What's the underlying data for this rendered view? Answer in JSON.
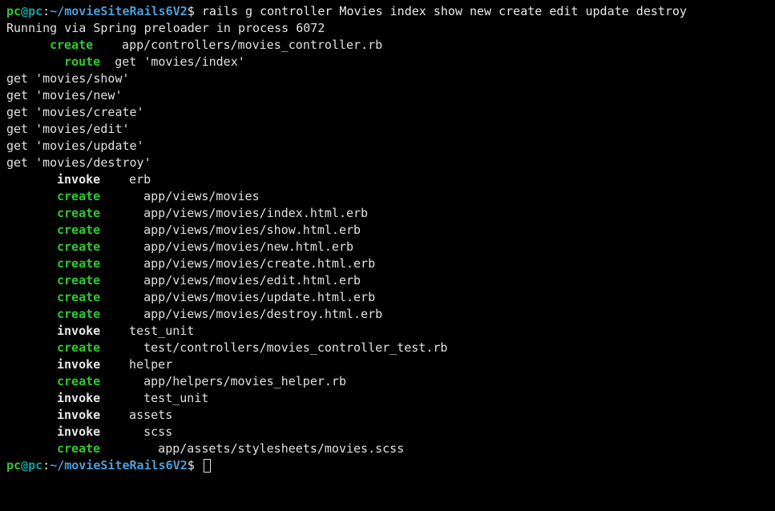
{
  "prompt1": {
    "user": "pc",
    "at": "@",
    "host": "pc",
    "colon": ":",
    "path": "~/movieSiteRails6V2",
    "dollar": "$",
    "command": "rails g controller Movies index show new create edit update destroy"
  },
  "lines": {
    "spring": "Running via Spring preloader in process 6072",
    "create1_action": "create",
    "create1_path": "  app/controllers/movies_controller.rb",
    "route_action": "route",
    "route_path": "  get 'movies/index'",
    "get_show": "get 'movies/show'",
    "get_new": "get 'movies/new'",
    "get_create": "get 'movies/create'",
    "get_edit": "get 'movies/edit'",
    "get_update": "get 'movies/update'",
    "get_destroy": "get 'movies/destroy'",
    "invoke_erb_action": "invoke",
    "invoke_erb_path": "  erb",
    "create_views_action": "create",
    "create_views_path": "    app/views/movies",
    "create_index_action": "create",
    "create_index_path": "    app/views/movies/index.html.erb",
    "create_show_action": "create",
    "create_show_path": "    app/views/movies/show.html.erb",
    "create_new_action": "create",
    "create_new_path": "    app/views/movies/new.html.erb",
    "create_create_action": "create",
    "create_create_path": "    app/views/movies/create.html.erb",
    "create_edit_action": "create",
    "create_edit_path": "    app/views/movies/edit.html.erb",
    "create_update_action": "create",
    "create_update_path": "    app/views/movies/update.html.erb",
    "create_destroy_action": "create",
    "create_destroy_path": "    app/views/movies/destroy.html.erb",
    "invoke_testunit_action": "invoke",
    "invoke_testunit_path": "  test_unit",
    "create_test_action": "create",
    "create_test_path": "    test/controllers/movies_controller_test.rb",
    "invoke_helper_action": "invoke",
    "invoke_helper_path": "  helper",
    "create_helper_action": "create",
    "create_helper_path": "    app/helpers/movies_helper.rb",
    "invoke_testunit2_action": "invoke",
    "invoke_testunit2_path": "    test_unit",
    "invoke_assets_action": "invoke",
    "invoke_assets_path": "  assets",
    "invoke_scss_action": "invoke",
    "invoke_scss_path": "    scss",
    "create_scss_action": "create",
    "create_scss_path": "      app/assets/stylesheets/movies.scss"
  },
  "prompt2": {
    "user": "pc",
    "at": "@",
    "host": "pc",
    "colon": ":",
    "path": "~/movieSiteRails6V2",
    "dollar": "$"
  }
}
